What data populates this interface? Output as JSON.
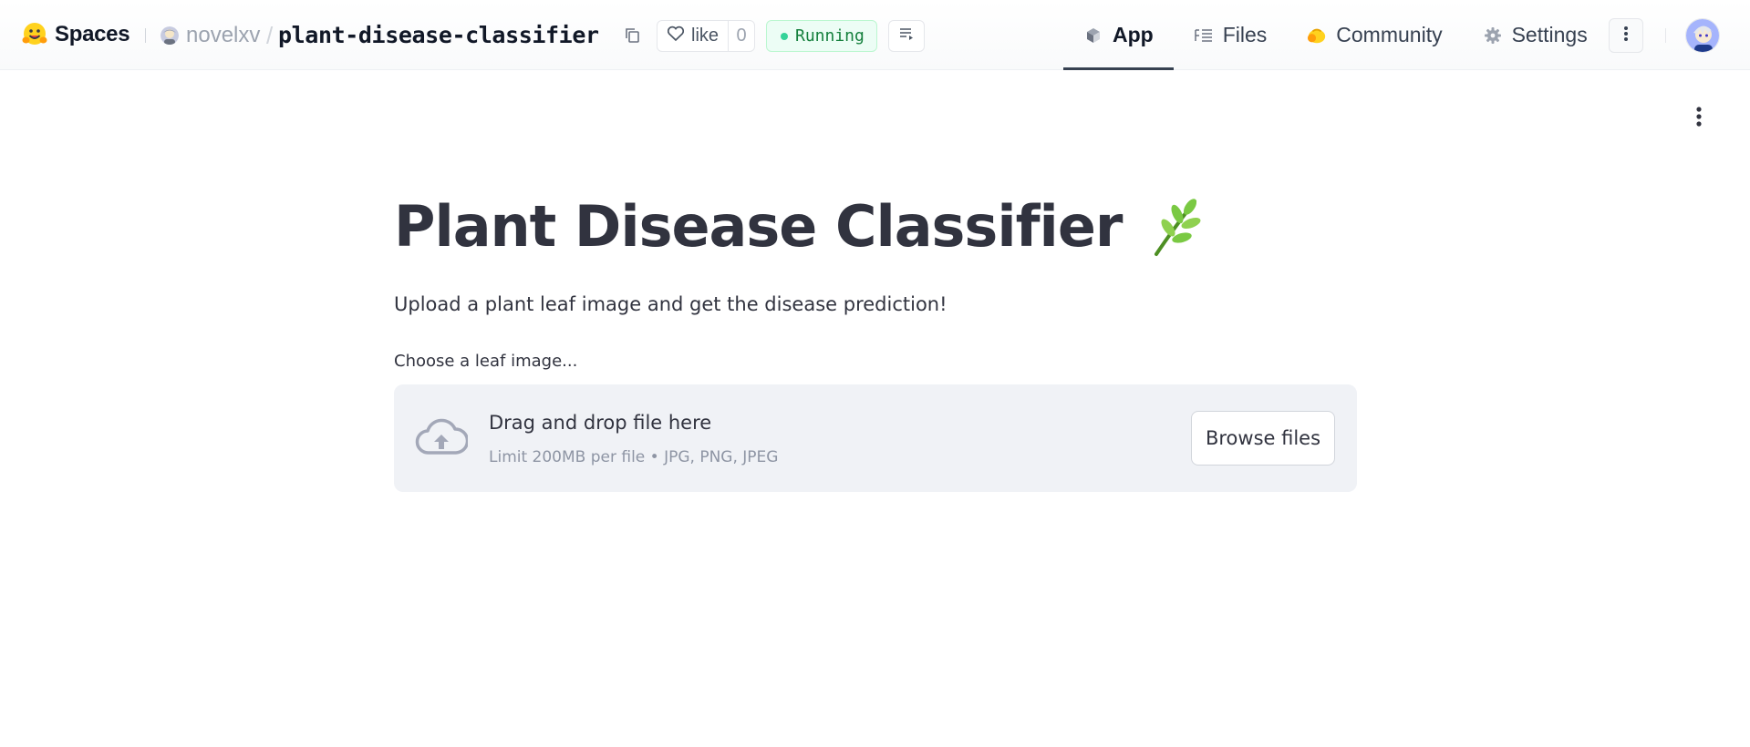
{
  "header": {
    "brand": "Spaces",
    "owner": "novelxv",
    "separator": "/",
    "repo": "plant-disease-classifier",
    "like_label": "like",
    "like_count": "0",
    "status": "Running",
    "tabs": [
      {
        "label": "App",
        "icon": "app-cube-icon",
        "active": true
      },
      {
        "label": "Files",
        "icon": "files-icon",
        "active": false
      },
      {
        "label": "Community",
        "icon": "community-icon",
        "active": false
      },
      {
        "label": "Settings",
        "icon": "gear-icon",
        "active": false
      }
    ]
  },
  "main": {
    "title": "Plant Disease Classifier",
    "title_emoji": "herb-icon",
    "subtitle": "Upload a plant leaf image and get the disease prediction!",
    "uploader": {
      "label": "Choose a leaf image...",
      "drop_title": "Drag and drop file here",
      "limit": "Limit 200MB per file • JPG, PNG, JPEG",
      "browse_label": "Browse files"
    }
  },
  "colors": {
    "status_green": "#15803d",
    "status_bg": "#ecfdf5",
    "dropzone_bg": "#f0f2f6",
    "title_text": "#31333f"
  }
}
